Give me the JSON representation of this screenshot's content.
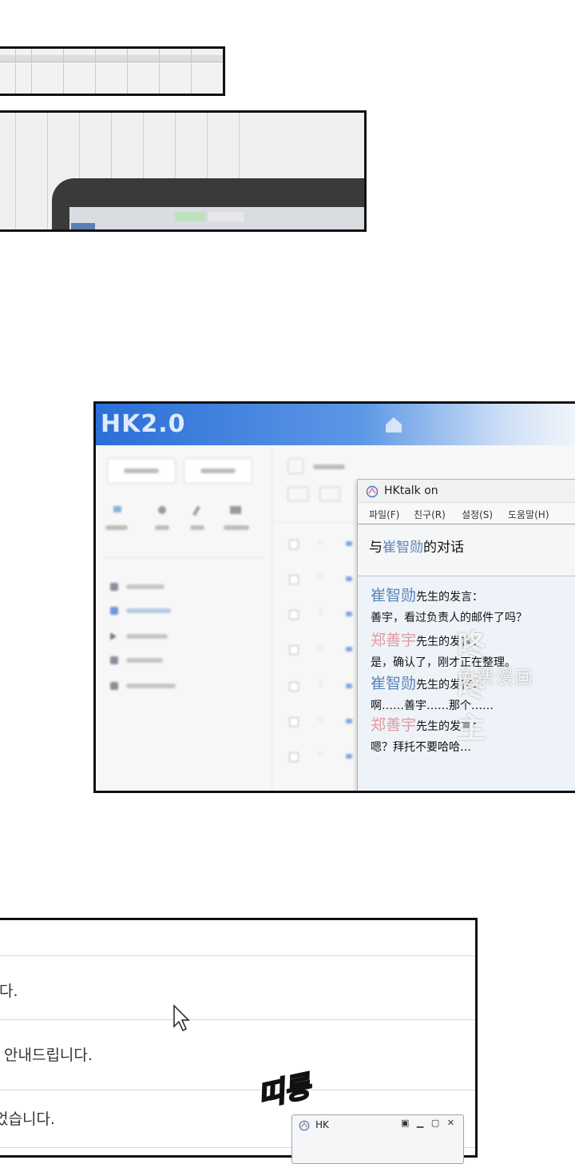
{
  "panel_top": {},
  "hk_app": {
    "title": "HK2.0"
  },
  "hktalk": {
    "window_title": "HKtalk on",
    "menu": [
      "파일(F)",
      "친구(R)",
      "설정(S)",
      "도움말(H)"
    ],
    "subject_prefix": "与",
    "subject_name": "崔智勋",
    "subject_suffix": "的对话",
    "messages": [
      {
        "speaker": "崔智勋",
        "said": "先生的发言：",
        "text": "善宇，看过负责人的邮件了吗？",
        "color": "#5b84b8"
      },
      {
        "speaker": "郑善宇",
        "said": "先生的发言：",
        "text": "是，确认了，刚才正在整理。",
        "color": "#e29aa0"
      },
      {
        "speaker": "崔智勋",
        "said": "先生的发言：",
        "text": "啊……善宇……那个……",
        "color": "#5b84b8"
      },
      {
        "speaker": "郑善宇",
        "said": "先生的发言：",
        "text": "嗯？拜托不要哈哈…",
        "color": "#e29aa0"
      }
    ]
  },
  "watermark": {
    "line1": "咚咚主",
    "line2": "免费漫画"
  },
  "mail_list": {
    "rows": [
      "다.",
      "안내드립니다.",
      "었습니다."
    ]
  },
  "sfx": "띠롱",
  "mini_window": {
    "title": "HK",
    "controls": "▣ ▁ ▢ ✕"
  }
}
